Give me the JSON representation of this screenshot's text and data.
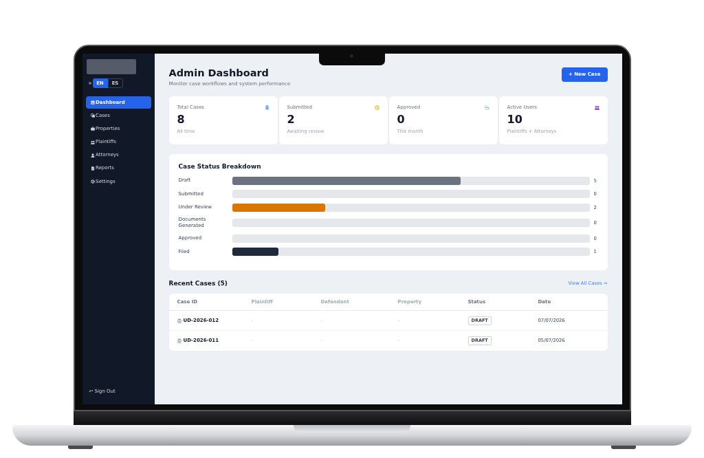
{
  "sidebar": {
    "language_toggle": [
      {
        "label": "EN",
        "selected": true
      },
      {
        "label": "ES",
        "selected": false
      }
    ],
    "nav_items": [
      {
        "label": "Dashboard",
        "selected": true
      },
      {
        "label": "Cases",
        "selected": false
      },
      {
        "label": "Properties",
        "selected": false
      },
      {
        "label": "Plaintiffs",
        "selected": false
      },
      {
        "label": "Attorneys",
        "selected": false
      },
      {
        "label": "Reports",
        "selected": false
      },
      {
        "label": "Settings",
        "selected": false
      }
    ],
    "sign_out": "↩ Sign Out"
  },
  "header": {
    "title": "Admin Dashboard",
    "subtitle": "Monitor case workflows and system performance",
    "new_case_button": "+ New Case"
  },
  "stats": [
    {
      "label": "Total Cases",
      "value": "8",
      "note": "All time"
    },
    {
      "label": "Submitted",
      "value": "2",
      "note": "Awaiting review"
    },
    {
      "label": "Approved",
      "value": "0",
      "note": "This month"
    },
    {
      "label": "Active Users",
      "value": "10",
      "note": "Plaintiffs + Attorneys"
    }
  ],
  "breakdown": {
    "title": "Case Status Breakdown",
    "rows": [
      {
        "label": "Draft",
        "count": "5",
        "level": 0.64,
        "color": "#6b7280"
      },
      {
        "label": "Submitted",
        "count": "0"
      },
      {
        "label": "Under Review",
        "count": "2",
        "level": 0.26,
        "color": "#d97706"
      },
      {
        "label": "Documents Generated",
        "count": "0"
      },
      {
        "label": "Approved",
        "count": "0"
      },
      {
        "label": "Filed",
        "count": "1",
        "level": 0.13,
        "color": "#1e293b"
      }
    ]
  },
  "recent_cases": {
    "title": "Recent Cases (5)",
    "view_all_link": "View All Cases →",
    "columns": [
      {
        "label": "Case ID",
        "muted": false
      },
      {
        "label": "Plaintiff",
        "muted": true
      },
      {
        "label": "Defendant",
        "muted": true
      },
      {
        "label": "Property",
        "muted": true
      },
      {
        "label": "Status",
        "muted": false
      },
      {
        "label": "Date",
        "muted": false
      }
    ],
    "rows": [
      {
        "case_id": "UD-2026-012",
        "plaintiff": "-",
        "defendant": "-",
        "property": "-",
        "status": "DRAFT",
        "date": "07/07/2026"
      },
      {
        "case_id": "UD-2026-011",
        "plaintiff": "-",
        "defendant": "-",
        "property": "-",
        "status": "DRAFT",
        "date": "05/07/2026"
      }
    ]
  }
}
